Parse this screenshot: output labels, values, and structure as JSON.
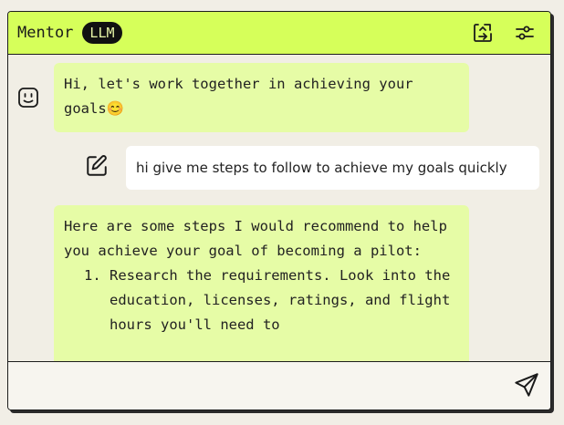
{
  "header": {
    "title": "Mentor",
    "badge": "LLM",
    "icons": [
      "swap-icon",
      "settings-sliders-icon"
    ]
  },
  "messages": {
    "bot_greeting": "Hi, let's work together in achieving your goals",
    "bot_greeting_emoji": "😊",
    "user_message": "hi give me steps to follow to achieve my goals quickly",
    "bot_reply_intro": "Here are some steps I would recommend to help you achieve your goal of becoming a pilot:",
    "bot_reply_steps": [
      "Research the requirements. Look into the education, licenses, ratings, and flight hours you'll need to"
    ]
  },
  "composer": {
    "placeholder": "",
    "send_icon": "send-icon"
  },
  "colors": {
    "header_bg": "#d6ff5a",
    "bot_bubble": "#e6fca6",
    "user_bubble": "#ffffff",
    "page_bg": "#f1eee6",
    "badge_bg": "#111111"
  }
}
